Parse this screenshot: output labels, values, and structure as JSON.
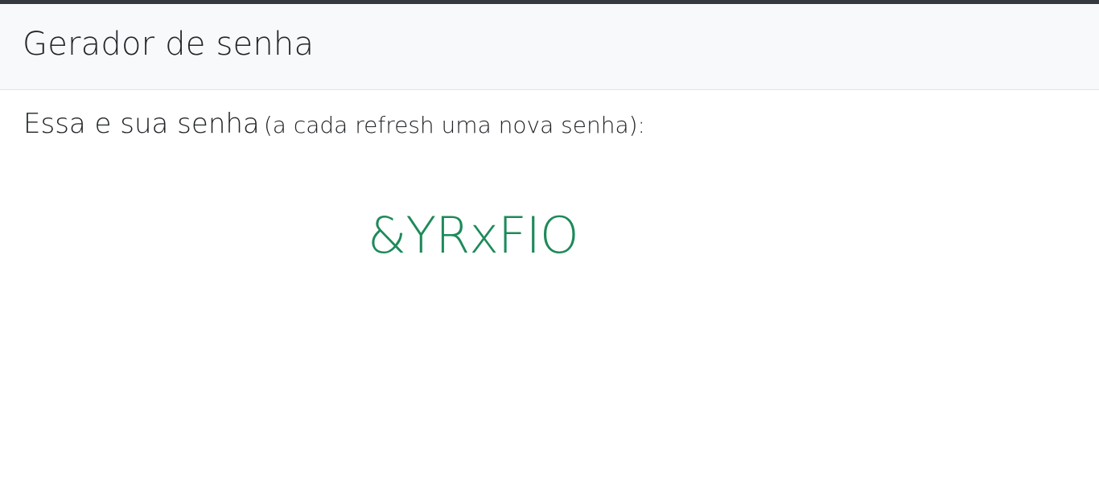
{
  "header": {
    "title": "Gerador de senha"
  },
  "main": {
    "intro_text": "Essa e sua senha",
    "intro_note": "(a cada refresh uma nova senha):",
    "password": "&YRxFIO"
  },
  "colors": {
    "top_strip": "#343a40",
    "navbar_bg": "#f8f9fa",
    "password_text": "#1e8a5a"
  }
}
